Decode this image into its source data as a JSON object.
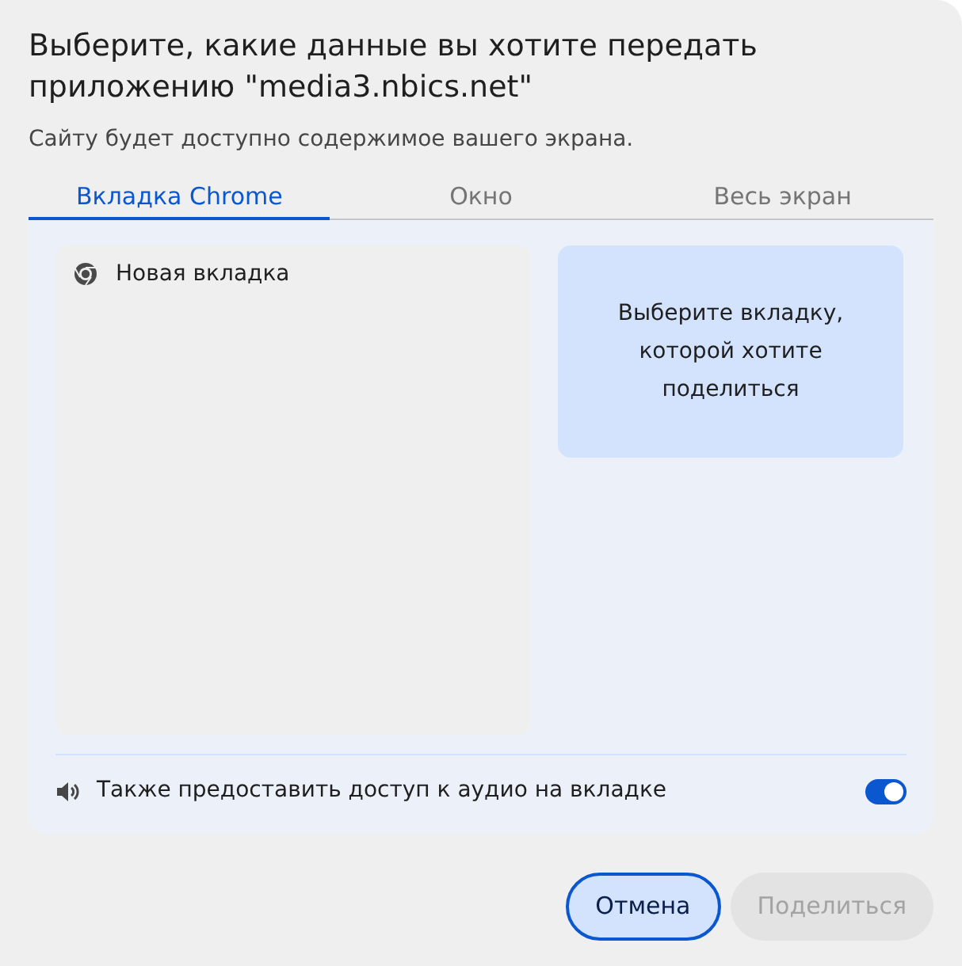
{
  "title": "Выберите, какие данные вы хотите передать приложению \"media3.nbics.net\"",
  "subtitle": "Сайту будет доступно содержимое вашего экрана.",
  "tabs": [
    {
      "label": "Вкладка Chrome",
      "selected": true
    },
    {
      "label": "Окно",
      "selected": false
    },
    {
      "label": "Весь экран",
      "selected": false
    }
  ],
  "sources": [
    {
      "label": "Новая вкладка",
      "selected": false
    }
  ],
  "preview_text": "Выберите вкладку, которой хотите поделиться",
  "audio": {
    "label": "Также предоставить доступ к аудио на вкладке",
    "on": true
  },
  "buttons": [
    {
      "label": "Отмена",
      "focused": true,
      "disabled": false
    },
    {
      "label": "Поделиться",
      "focused": false,
      "disabled": true
    }
  ]
}
